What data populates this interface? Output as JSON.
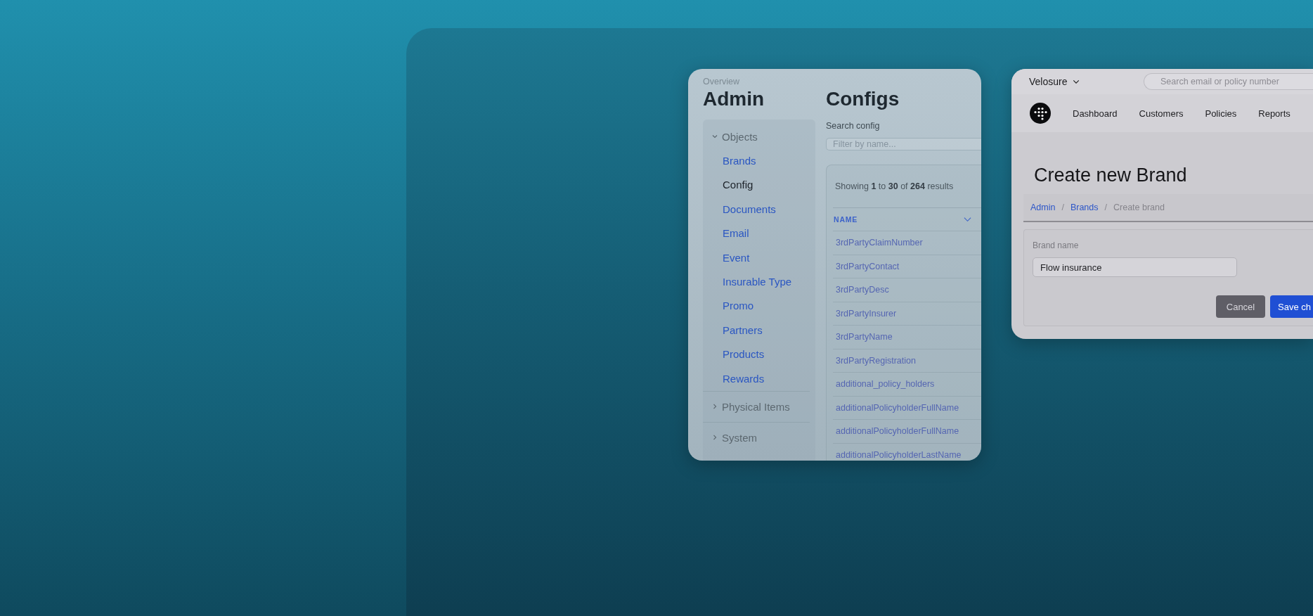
{
  "admin_window": {
    "overview_label": "Overview",
    "title": "Admin",
    "sidebar": {
      "groups": [
        {
          "label": "Objects",
          "expanded": true,
          "items": [
            {
              "label": "Brands",
              "selected": false
            },
            {
              "label": "Config",
              "selected": true
            },
            {
              "label": "Documents",
              "selected": false
            },
            {
              "label": "Email",
              "selected": false
            },
            {
              "label": "Event",
              "selected": false
            },
            {
              "label": "Insurable Type",
              "selected": false
            },
            {
              "label": "Promo",
              "selected": false
            },
            {
              "label": "Partners",
              "selected": false
            },
            {
              "label": "Products",
              "selected": false
            },
            {
              "label": "Rewards",
              "selected": false
            }
          ]
        },
        {
          "label": "Physical Items",
          "expanded": false
        },
        {
          "label": "System",
          "expanded": false
        }
      ]
    },
    "configs": {
      "title": "Configs",
      "search_label": "Search config",
      "search": {
        "placeholder": "Filter by name..."
      },
      "summary": "Showing **1** to **30** of **264** results",
      "table": {
        "columns": [
          "NAME"
        ],
        "rows": [
          "3rdPartyClaimNumber",
          "3rdPartyContact",
          "3rdPartyDesc",
          "3rdPartyInsurer",
          "3rdPartyName",
          "3rdPartyRegistration",
          "additional_policy_holders",
          "additionalPolicyholderFullName",
          "additionalPolicyholderFullName",
          "additionalPolicyholderLastName"
        ]
      }
    }
  },
  "brand_window": {
    "brand_switcher": "Velosure",
    "search": {
      "placeholder": "Search email or policy number"
    },
    "nav": [
      "Dashboard",
      "Customers",
      "Policies",
      "Reports"
    ],
    "page_title": "Create new Brand",
    "breadcrumb_separator": "/",
    "breadcrumbs": [
      {
        "label": "Admin",
        "kind": "link"
      },
      {
        "label": "Brands",
        "kind": "link"
      },
      {
        "label": "Create brand",
        "kind": "current"
      }
    ],
    "form": {
      "field_label": "Brand name",
      "value": "Flow insurance"
    },
    "buttons": [
      {
        "label": "Cancel",
        "kind": "secondary"
      },
      {
        "label": "Save ch",
        "kind": "primary"
      }
    ]
  }
}
